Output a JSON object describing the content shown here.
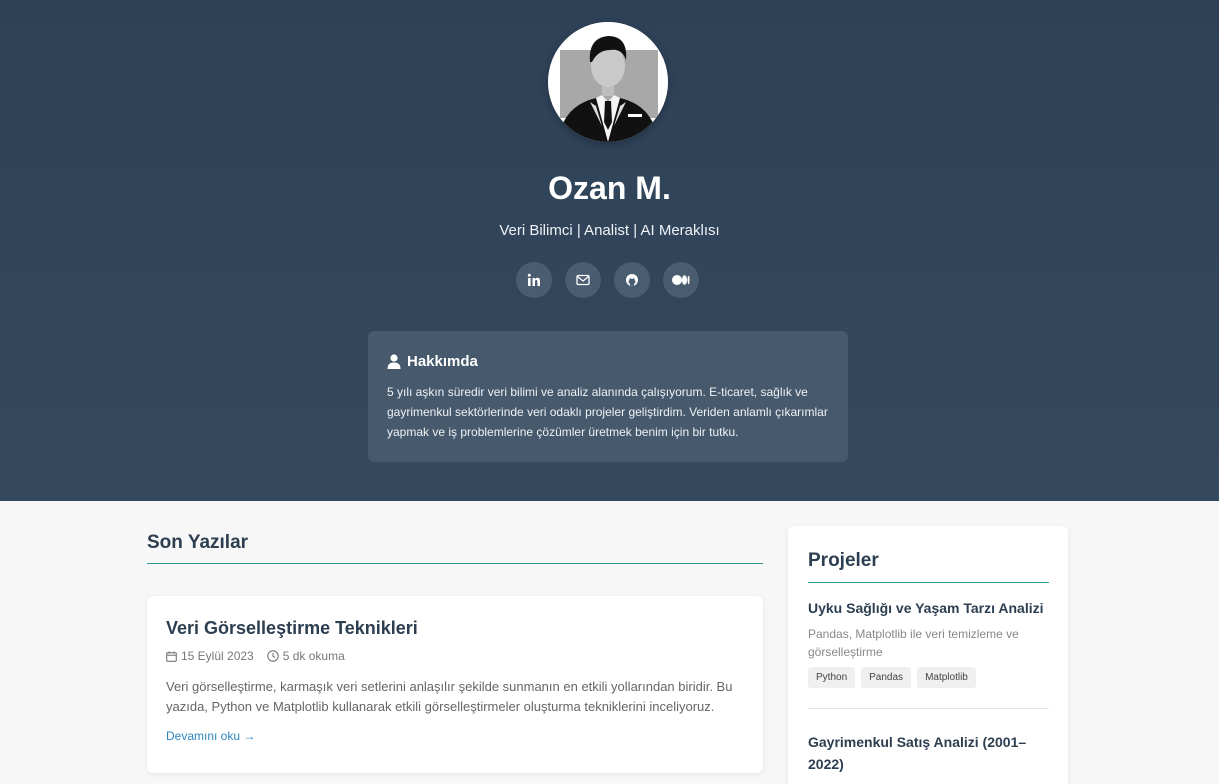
{
  "profile": {
    "name": "Ozan M.",
    "subtitle": "Veri Bilimci | Analist | AI Meraklısı"
  },
  "socials": [
    {
      "icon": "linkedin-icon"
    },
    {
      "icon": "mail-icon"
    },
    {
      "icon": "github-icon"
    },
    {
      "icon": "medium-icon"
    }
  ],
  "about": {
    "title": "Hakkımda",
    "text": "5 yılı aşkın süredir veri bilimi ve analiz alanında çalışıyorum. E-ticaret, sağlık ve gayrimenkul sektörlerinde veri odaklı projeler geliştirdim. Veriden anlamlı çıkarımlar yapmak ve iş problemlerine çözümler üretmek benim için bir tutku."
  },
  "posts_section": {
    "title": "Son Yazılar"
  },
  "posts": [
    {
      "title": "Veri Görselleştirme Teknikleri",
      "date": "15 Eylül 2023",
      "read_time": "5 dk okuma",
      "excerpt": "Veri görselleştirme, karmaşık veri setlerini anlaşılır şekilde sunmanın en etkili yollarından biridir. Bu yazıda, Python ve Matplotlib kullanarak etkili görselleştirmeler oluşturma tekniklerini inceliyoruz.",
      "read_more": "Devamını oku →"
    }
  ],
  "projects_section": {
    "title": "Projeler"
  },
  "projects": [
    {
      "title": "Uyku Sağlığı ve Yaşam Tarzı Analizi",
      "description": "Pandas, Matplotlib ile veri temizleme ve görselleştirme",
      "tags": [
        "Python",
        "Pandas",
        "Matplotlib"
      ]
    },
    {
      "title": "Gayrimenkul Satış Analizi (2001–2022)"
    }
  ],
  "colors": {
    "hero": "#34495e",
    "accent": "#2a9d9b",
    "link": "#2e86c1"
  }
}
